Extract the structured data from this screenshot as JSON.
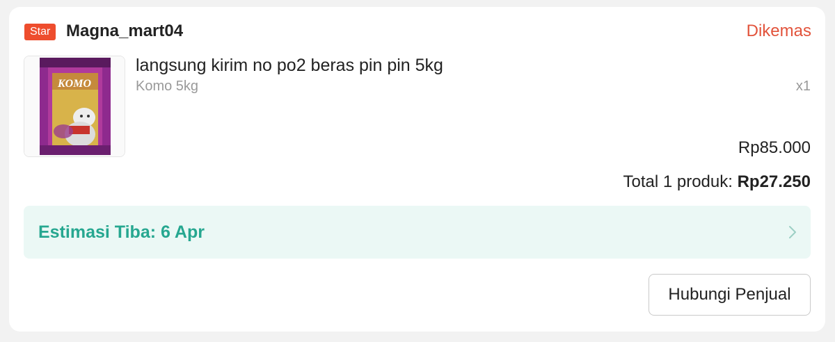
{
  "order": {
    "shop": {
      "badge": "Star",
      "name": "Magna_mart04"
    },
    "status": "Dikemas",
    "product": {
      "name": "langsung kirim no po2 beras pin pin 5kg",
      "variant": "Komo 5kg",
      "quantity": "x1",
      "price": "Rp85.000",
      "image_text": "KOMO"
    },
    "total": {
      "label": "Total 1 produk:",
      "value": "Rp27.250"
    },
    "estimate": {
      "label": "Estimasi Tiba:",
      "date": "6 Apr"
    },
    "contact_button": "Hubungi Penjual"
  },
  "colors": {
    "brand": "#ee4d2d",
    "status": "#e2533b",
    "eta_text": "#26a790",
    "eta_background": "#ebf8f5"
  }
}
